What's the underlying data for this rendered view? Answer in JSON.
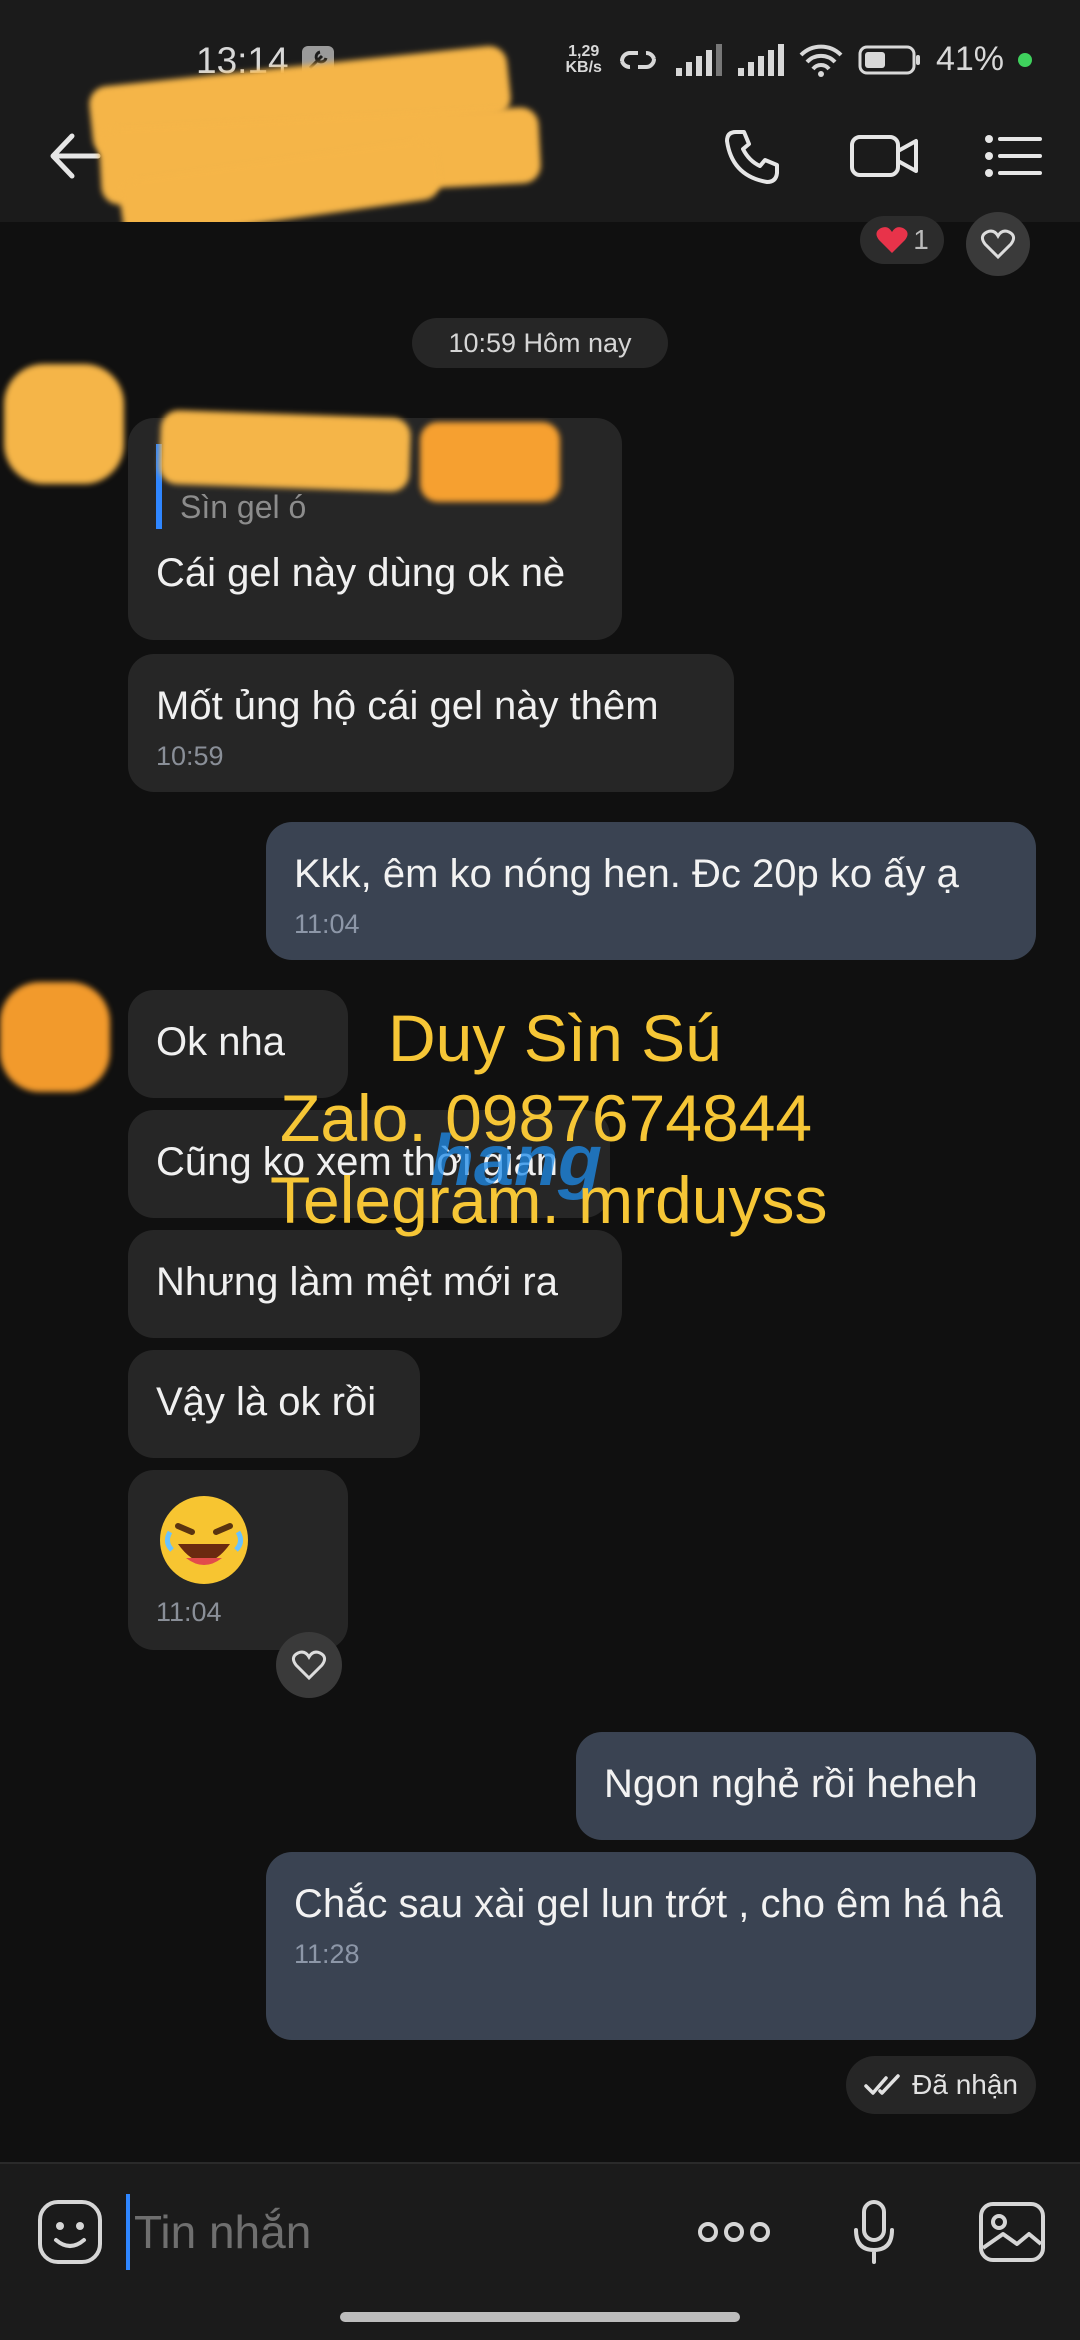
{
  "status": {
    "time": "13:14",
    "net_speed_top": "1,29",
    "net_speed_bottom": "KB/s",
    "battery": "41%"
  },
  "header": {
    "contact_name": "",
    "back_icon": "back-arrow-icon",
    "call_icon": "phone-icon",
    "video_icon": "video-camera-icon",
    "menu_icon": "menu-icon"
  },
  "chat": {
    "prev_reaction_count": "1",
    "date_divider": "10:59 Hôm nay",
    "messages": [
      {
        "dir": "in",
        "quote_name": "",
        "quote_text": "Sìn gel ó",
        "text": "Cái gel này dùng ok nè"
      },
      {
        "dir": "in",
        "text": "Mốt ủng hộ cái gel này thêm",
        "time": "10:59"
      },
      {
        "dir": "out",
        "text": "Kkk, êm ko nóng hen. Đc 20p ko ấy ạ",
        "time": "11:04"
      },
      {
        "dir": "in",
        "text": "Ok nha"
      },
      {
        "dir": "in",
        "text": "Cũng ko xem thời gian"
      },
      {
        "dir": "in",
        "text": "Nhưng làm mệt mới ra"
      },
      {
        "dir": "in",
        "text": "Vậy là ok rồi"
      },
      {
        "dir": "in",
        "text": "",
        "emoji": "laughing-face-emoji",
        "time": "11:04"
      },
      {
        "dir": "out",
        "text": "Ngon nghẻ rồi heheh"
      },
      {
        "dir": "out",
        "text": "Chắc sau xài gel lun trớt , cho êm há hâ",
        "time": "11:28"
      }
    ],
    "delivery_status": "Đã nhận"
  },
  "watermark": {
    "line1": "Duy Sìn Sú",
    "line2": "Zalo. 0987674844",
    "line3": "Telegram. mrduyss",
    "logo": "hang"
  },
  "input": {
    "placeholder": "Tin nhắn",
    "emoji_icon": "sticker-face-icon",
    "more_icon": "more-dots-icon",
    "mic_icon": "microphone-icon",
    "image_icon": "image-gallery-icon"
  },
  "colors": {
    "background": "#101010",
    "bar": "#1b1b1b",
    "bubble_in": "#262626",
    "bubble_out": "#3a4352",
    "accent": "#2f86ff",
    "watermark": "#f6c636",
    "redaction": "#f5b548"
  }
}
